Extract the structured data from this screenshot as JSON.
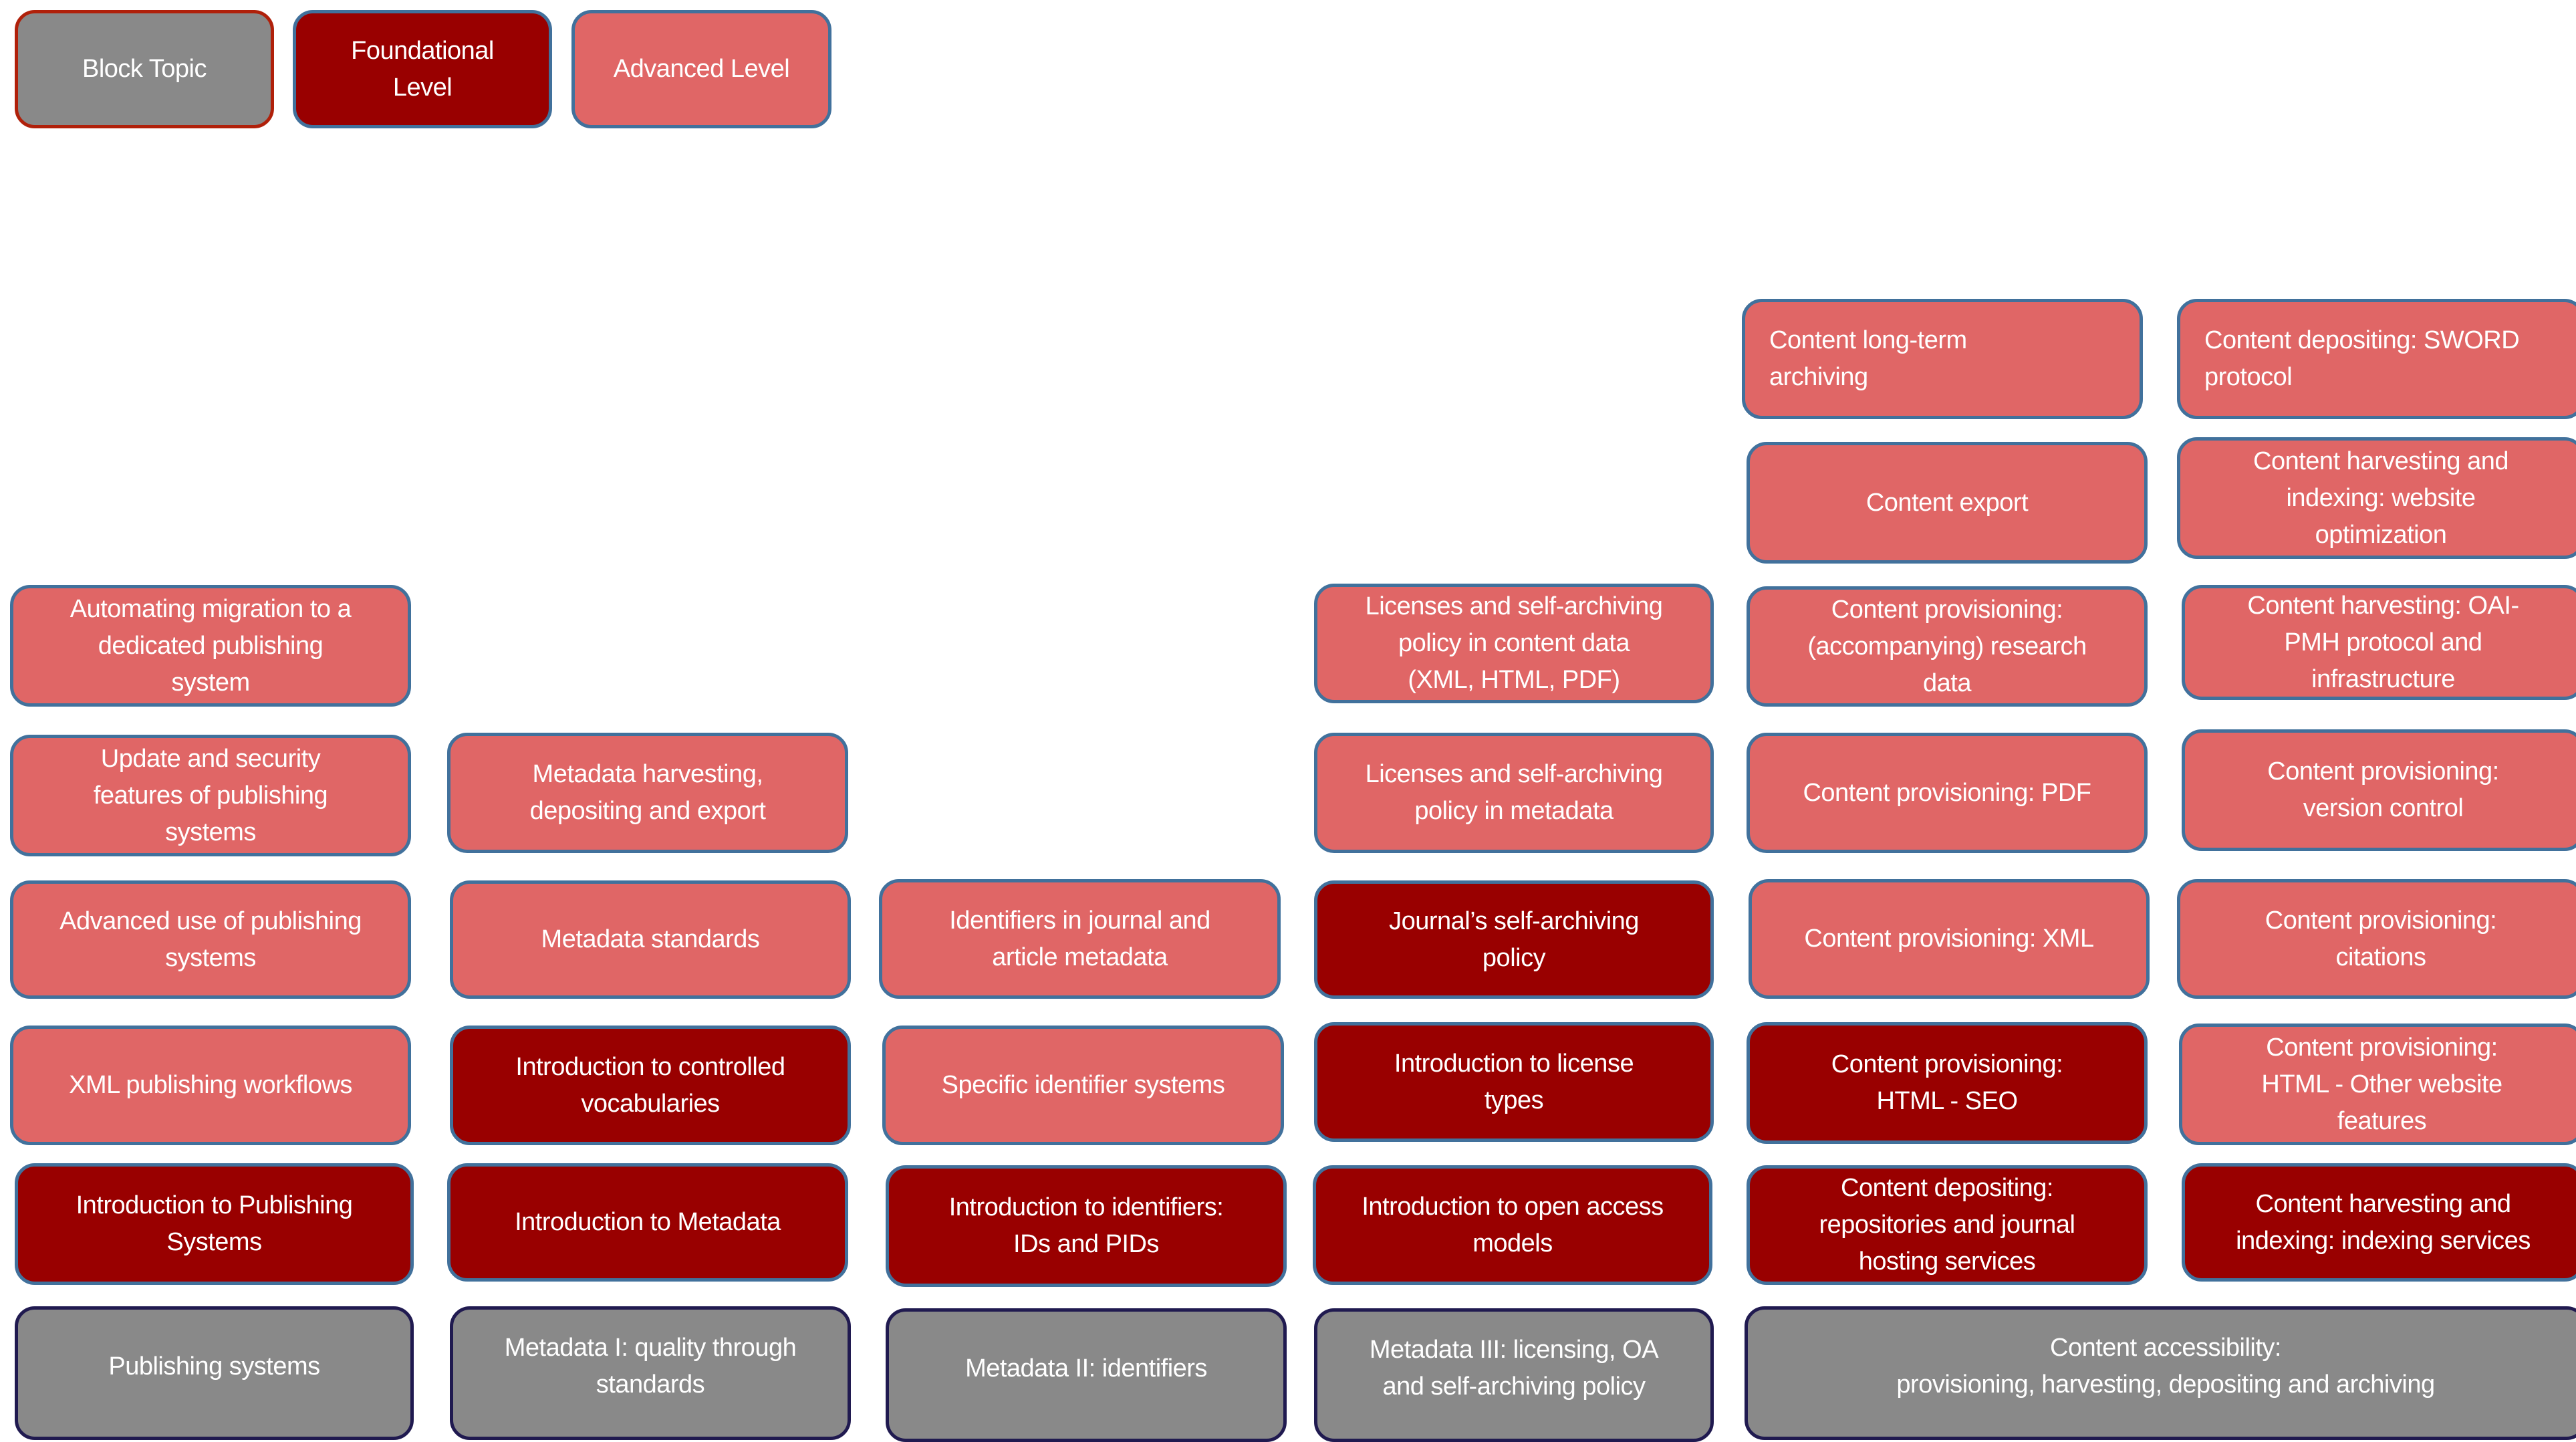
{
  "colors": {
    "block_topic": "#898989",
    "foundational": "#990000",
    "advanced": "#E06666",
    "box_border": "#41719C",
    "block_border": "#201A50"
  },
  "legend": [
    {
      "label": "Block Topic",
      "level": "block"
    },
    {
      "label": "Foundational\nLevel",
      "level": "foundational"
    },
    {
      "label": "Advanced Level",
      "level": "advanced"
    }
  ],
  "columns": [
    {
      "block": "Publishing systems",
      "foundational": [
        "Introduction to Publishing\nSystems"
      ],
      "advanced": [
        "XML publishing workflows",
        "Advanced use of publishing\nsystems",
        "Update and security\nfeatures of publishing\nsystems",
        "Automating migration to a\ndedicated publishing\nsystem"
      ]
    },
    {
      "block": "Metadata I: quality through\nstandards",
      "foundational": [
        "Introduction to Metadata",
        "Introduction to controlled\nvocabularies"
      ],
      "advanced": [
        "Metadata standards",
        "Metadata harvesting,\ndepositing and export"
      ]
    },
    {
      "block": "Metadata II: identifiers",
      "foundational": [
        "Introduction to identifiers:\nIDs and PIDs"
      ],
      "advanced": [
        "Specific identifier systems",
        "Identifiers in journal and\narticle metadata"
      ]
    },
    {
      "block": "Metadata III: licensing, OA\nand self-archiving policy",
      "foundational": [
        "Introduction to open access\nmodels",
        "Introduction to license\ntypes",
        "Journal’s self-archiving\npolicy"
      ],
      "advanced": [
        "Licenses and self-archiving\npolicy in metadata",
        "Licenses and self-archiving\npolicy in content data\n(XML, HTML, PDF)"
      ]
    },
    {
      "block": "Content accessibility:\nprovisioning, harvesting, depositing and archiving",
      "foundational_a": [
        "Content depositing:\nrepositories and journal\nhosting services",
        "Content provisioning:\nHTML - SEO"
      ],
      "advanced_a": [
        "Content provisioning: XML",
        "Content provisioning: PDF",
        "Content provisioning:\n(accompanying) research\ndata",
        "Content export",
        "Content long-term\narchiving"
      ],
      "foundational_b": [
        "Content harvesting and\nindexing: indexing services"
      ],
      "advanced_b": [
        "Content provisioning:\nHTML - Other website\nfeatures",
        "Content provisioning:\ncitations",
        "Content provisioning:\nversion control",
        "Content harvesting: OAI-\nPMH protocol and\ninfrastructure",
        "Content harvesting and\nindexing: website\noptimization",
        "Content depositing: SWORD\nprotocol"
      ]
    }
  ]
}
